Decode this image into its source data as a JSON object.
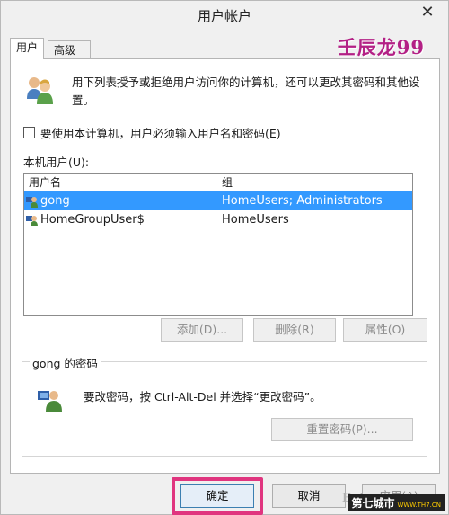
{
  "window": {
    "title": "用户帐户"
  },
  "watermark": {
    "author": "壬辰龙99",
    "corner": "Bai",
    "site": "第七城市",
    "site_url": "WWW.TH7.CN"
  },
  "tabs": [
    {
      "label": "用户"
    },
    {
      "label": "高级"
    }
  ],
  "intro_text": "用下列表授予或拒绝用户访问你的计算机，还可以更改其密码和其他设置。",
  "require_login": {
    "label": "要使用本计算机，用户必须输入用户名和密码(E)",
    "checked": false
  },
  "local_users": {
    "label": "本机用户(U):",
    "columns": [
      "用户名",
      "组"
    ],
    "rows": [
      {
        "name": "gong",
        "group": "HomeUsers; Administrators",
        "selected": true
      },
      {
        "name": "HomeGroupUser$",
        "group": "HomeUsers",
        "selected": false
      }
    ]
  },
  "list_buttons": {
    "add": "添加(D)...",
    "remove": "删除(R)",
    "properties": "属性(O)"
  },
  "password": {
    "title": "gong 的密码",
    "text": "要改密码，按 Ctrl-Alt-Del 并选择“更改密码”。",
    "reset_label": "重置密码(P)..."
  },
  "dialog_buttons": {
    "ok": "确定",
    "cancel": "取消",
    "apply": "应用(A)"
  },
  "colors": {
    "selection": "#3399ff",
    "highlight_box": "#e0357f",
    "watermark": "#b32085"
  }
}
